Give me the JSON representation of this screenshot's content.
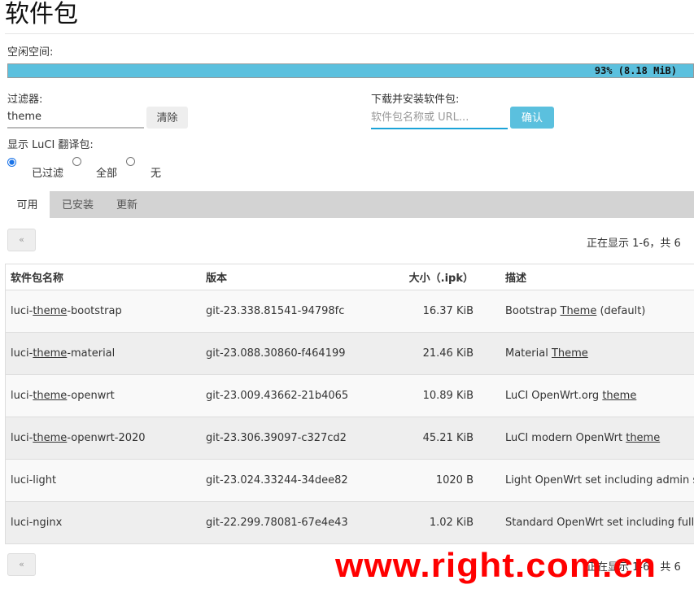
{
  "page": {
    "title": "软件包"
  },
  "free_space": {
    "label": "空闲空间:",
    "percent": 93,
    "text": "93% (8.18 MiB)",
    "bar_color": "#5bc0de"
  },
  "filter": {
    "label": "过滤器:",
    "value": "theme",
    "clear_label": "清除"
  },
  "install": {
    "label": "下载并安装软件包:",
    "placeholder": "软件包名称或 URL...",
    "confirm_label": "确认",
    "accent": "#5bc0de"
  },
  "translations": {
    "label": "显示 LuCI 翻译包:",
    "options": [
      {
        "label": "已过滤",
        "checked": true
      },
      {
        "label": "全部",
        "checked": false
      },
      {
        "label": "无",
        "checked": false
      }
    ]
  },
  "tabs": [
    {
      "label": "可用",
      "active": true
    },
    {
      "label": "已安装",
      "active": false
    },
    {
      "label": "更新",
      "active": false
    }
  ],
  "pager": {
    "prev_label": "«",
    "status": "正在显示 1-6，共 6"
  },
  "table": {
    "headers": {
      "name": "软件包名称",
      "version": "版本",
      "size": "大小（.ipk）",
      "description": "描述"
    },
    "rows": [
      {
        "name_pre": "luci-",
        "name_hl": "theme",
        "name_post": "-bootstrap",
        "version": "git-23.338.81541-94798fc",
        "size": "16.37 KiB",
        "desc_pre": "Bootstrap ",
        "desc_hl": "Theme",
        "desc_post": " (default)"
      },
      {
        "name_pre": "luci-",
        "name_hl": "theme",
        "name_post": "-material",
        "version": "git-23.088.30860-f464199",
        "size": "21.46 KiB",
        "desc_pre": "Material ",
        "desc_hl": "Theme",
        "desc_post": ""
      },
      {
        "name_pre": "luci-",
        "name_hl": "theme",
        "name_post": "-openwrt",
        "version": "git-23.009.43662-21b4065",
        "size": "10.89 KiB",
        "desc_pre": "LuCI OpenWrt.org ",
        "desc_hl": "theme",
        "desc_post": ""
      },
      {
        "name_pre": "luci-",
        "name_hl": "theme",
        "name_post": "-openwrt-2020",
        "version": "git-23.306.39097-c327cd2",
        "size": "45.21 KiB",
        "desc_pre": "LuCI modern OpenWrt ",
        "desc_hl": "theme",
        "desc_post": ""
      },
      {
        "name_pre": "luci-light",
        "name_hl": "",
        "name_post": "",
        "version": "git-23.024.33244-34dee82",
        "size": "1020 B",
        "desc_pre": "Light OpenWrt set including admin su",
        "desc_hl": "",
        "desc_post": ""
      },
      {
        "name_pre": "luci-nginx",
        "name_hl": "",
        "name_post": "",
        "version": "git-22.299.78081-67e4e43",
        "size": "1.02 KiB",
        "desc_pre": "Standard OpenWrt set including full a",
        "desc_hl": "",
        "desc_post": ""
      }
    ]
  },
  "watermark": {
    "text": "www.right.com.cn",
    "color": "#ff0000"
  }
}
